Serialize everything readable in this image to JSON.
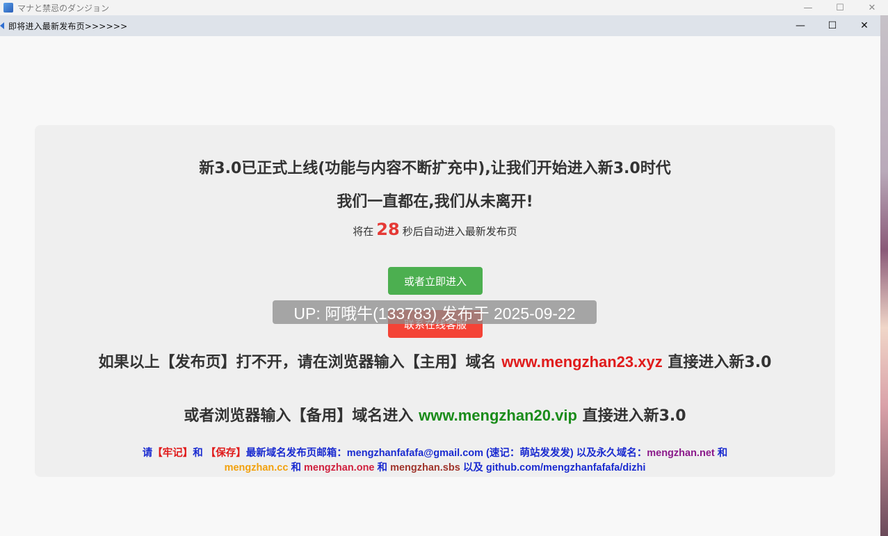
{
  "outer_window": {
    "title": "マナと禁忌のダンジョン",
    "controls": {
      "minimize": "—",
      "maximize": "☐",
      "close": "✕"
    }
  },
  "popup_window": {
    "title": "即将进入最新发布页>>>>>>",
    "controls": {
      "minimize": "—",
      "maximize": "☐",
      "close": "✕"
    }
  },
  "content": {
    "headline": "新3.0已正式上线(功能与内容不断扩充中),让我们开始进入新3.0时代",
    "subheadline": "我们一直都在,我们从未离开!",
    "countdown": {
      "prefix": "将在",
      "seconds": "28",
      "suffix": "秒后自动进入最新发布页"
    },
    "enter_button": "或者立即进入",
    "support_button": "联系在线客服",
    "primary_domain": {
      "prefix": "如果以上【发布页】打不开，请在浏览器输入【主用】域名",
      "domain": "www.mengzhan23.xyz",
      "suffix": "直接进入新3.0"
    },
    "backup_domain": {
      "prefix": "或者浏览器输入【备用】域名进入",
      "domain": "www.mengzhan20.vip",
      "suffix": "直接进入新3.0"
    },
    "footer": {
      "t1": "请",
      "t2": "【牢记】",
      "t3": "和",
      "t4": "【保存】",
      "t5": "最新域名发布页邮箱：mengzhanfafafa@gmail.com (速记：萌站发发发) 以及永久域名：",
      "d1": "mengzhan.net",
      "t6": "和",
      "d2": "mengzhan.cc",
      "t7": "和",
      "d3": "mengzhan.one",
      "t8": "和",
      "d4": "mengzhan.sbs",
      "t9": "以及 github.com/mengzhanfafafa/dizhi"
    }
  },
  "watermark": "UP: 阿哦牛(133783) 发布于 2025-09-22",
  "colors": {
    "green_button": "#4caf50",
    "red_button": "#f44336",
    "countdown_number": "#e53935",
    "primary_domain": "#e01b1b",
    "backup_domain": "#1a8c1a"
  }
}
